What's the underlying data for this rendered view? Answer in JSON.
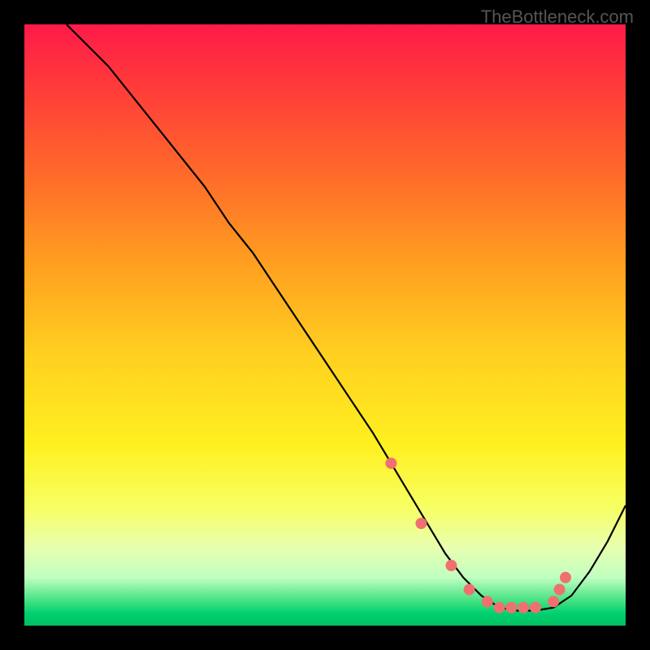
{
  "watermark": "TheBottleneck.com",
  "chart_data": {
    "type": "line",
    "title": "",
    "xlabel": "",
    "ylabel": "",
    "xlim": [
      0,
      100
    ],
    "ylim": [
      0,
      100
    ],
    "grid": false,
    "series": [
      {
        "name": "curve",
        "x": [
          7,
          10,
          14,
          18,
          22,
          26,
          30,
          34,
          38,
          42,
          46,
          50,
          54,
          58,
          61,
          64,
          67,
          70,
          73,
          76,
          79,
          82,
          85,
          88,
          91,
          94,
          97,
          100
        ],
        "y": [
          100,
          97,
          93,
          88,
          83,
          78,
          73,
          67,
          62,
          56,
          50,
          44,
          38,
          32,
          27,
          22,
          17,
          12,
          8,
          5,
          3,
          2.5,
          2.5,
          3,
          5,
          9,
          14,
          20
        ]
      }
    ],
    "markers": {
      "name": "dots",
      "x": [
        61,
        66,
        71,
        74,
        77,
        79,
        81,
        83,
        85,
        88,
        89,
        90
      ],
      "y": [
        27,
        17,
        10,
        6,
        4,
        3,
        3,
        3,
        3,
        4,
        6,
        8
      ]
    }
  }
}
